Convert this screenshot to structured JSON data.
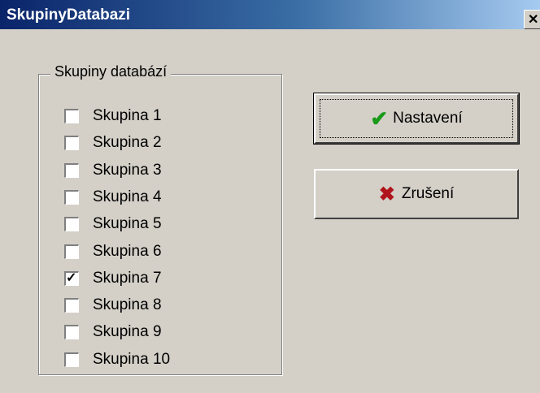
{
  "window": {
    "title": "SkupinyDatabazi",
    "close_glyph": "✕"
  },
  "group": {
    "label": "Skupiny databází",
    "items": [
      {
        "label": "Skupina 1",
        "checked": false
      },
      {
        "label": "Skupina 2",
        "checked": false
      },
      {
        "label": "Skupina 3",
        "checked": false
      },
      {
        "label": "Skupina 4",
        "checked": false
      },
      {
        "label": "Skupina 5",
        "checked": false
      },
      {
        "label": "Skupina 6",
        "checked": false
      },
      {
        "label": "Skupina 7",
        "checked": true
      },
      {
        "label": "Skupina 8",
        "checked": false
      },
      {
        "label": "Skupina 9",
        "checked": false
      },
      {
        "label": "Skupina 10",
        "checked": false
      }
    ]
  },
  "buttons": {
    "ok": {
      "label": "Nastavení",
      "icon": "green-check-icon",
      "color": "#1a9a1a"
    },
    "cancel": {
      "label": "Zrušení",
      "icon": "red-x-icon",
      "color": "#b0141c"
    }
  },
  "colors": {
    "dialog_bg": "#d4d0c8",
    "title_start": "#0a246a",
    "title_end": "#a6caf0"
  }
}
